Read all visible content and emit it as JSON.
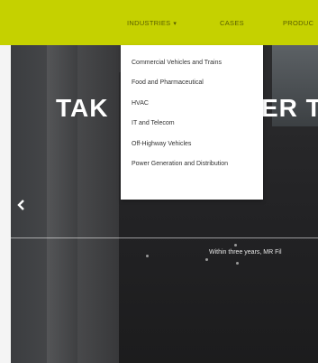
{
  "nav": {
    "items": [
      {
        "label": "INDUSTRIES"
      },
      {
        "label": "CASES"
      },
      {
        "label": "PRODUC"
      }
    ],
    "industries_chevron": "▾"
  },
  "dropdown": {
    "items": [
      {
        "label": "Commercial Vehicles and Trains"
      },
      {
        "label": "Food and Pharmaceutical"
      },
      {
        "label": "HVAC"
      },
      {
        "label": "IT and Telecom"
      },
      {
        "label": "Off-Highway Vehicles"
      },
      {
        "label": "Power Generation and Distribution"
      }
    ]
  },
  "hero": {
    "title_left": "TAK",
    "title_right": "ER T",
    "subtitle": "Within three years, MR Fil",
    "prev_icon": "chevron-left-icon"
  },
  "colors": {
    "topbar": "#c5d100",
    "dropdown_bg": "#ffffff",
    "hero_text": "#ffffff"
  }
}
